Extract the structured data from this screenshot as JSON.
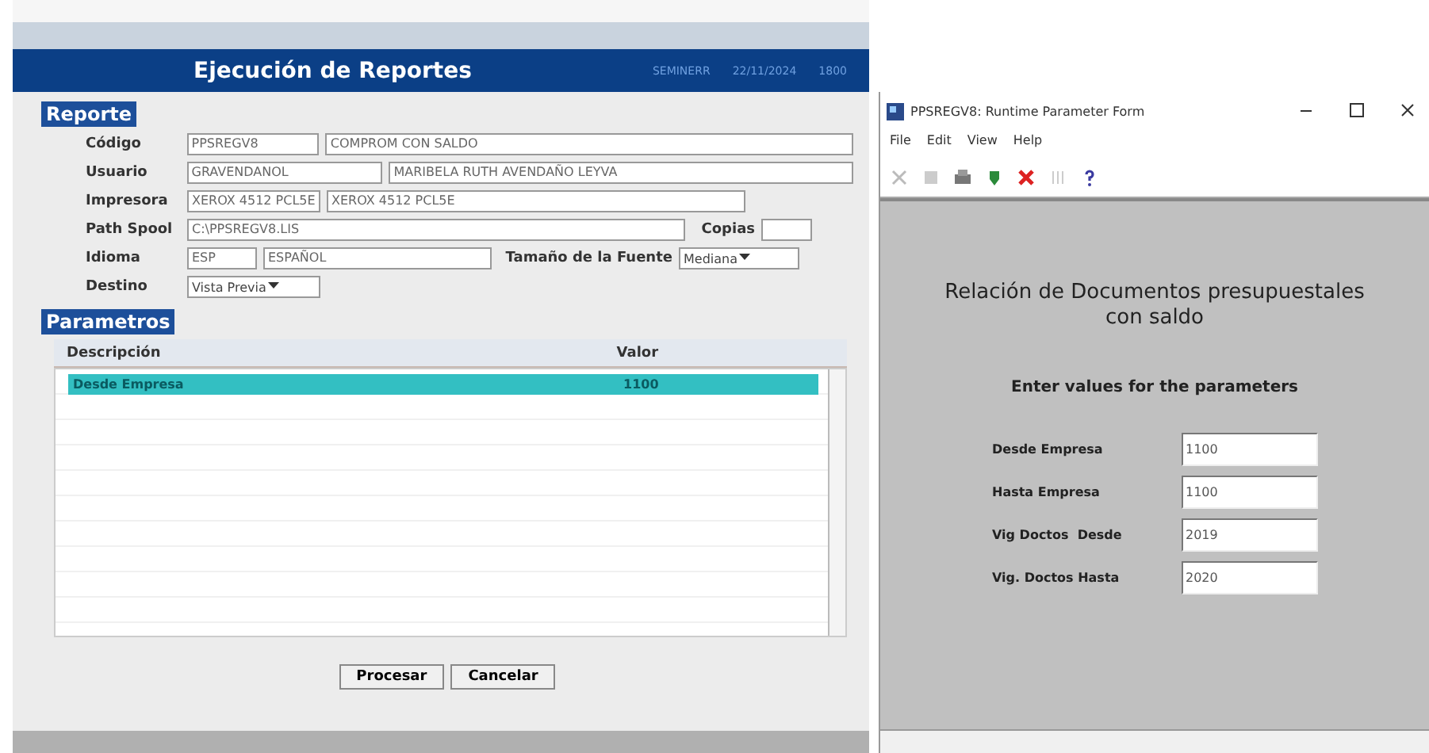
{
  "app_window": {
    "title": "Ejecución de Reportes",
    "header_info": [
      "SEMINERR",
      "22/11/2024",
      "1800"
    ]
  },
  "reporte": {
    "heading": "Reporte",
    "fields": [
      {
        "label": "Código",
        "values": [
          "PPSREGV8",
          "COMPROM CON SALDO"
        ]
      },
      {
        "label": "Usuario",
        "values": [
          "GRAVENDANOL",
          "MARIBELA RUTH AVENDAÑO LEYVA"
        ]
      },
      {
        "label": "Impresora",
        "values": [
          "XEROX 4512 PCL5E",
          "XEROX 4512 PCL5E"
        ]
      },
      {
        "label": "Path Spool",
        "values": [
          "C:\\PPSREGV8.LIS"
        ]
      },
      {
        "label": "Idioma",
        "values": [
          "ESP",
          "ESPAÑOL"
        ]
      },
      {
        "label": "Destino",
        "values": [
          "Vista Previa"
        ]
      }
    ],
    "copias_label": "Copias",
    "font_size_label": "Tamaño de la Fuente",
    "font_size_value": "Mediana"
  },
  "parametros": {
    "heading": "Parametros",
    "columns": [
      "Descripción",
      "Valor"
    ],
    "rows": [
      {
        "description": "Desde Empresa",
        "value": "1100",
        "selected": true
      }
    ]
  },
  "buttons": [
    "Procesar",
    "Cancelar"
  ],
  "param_window": {
    "title": "PPSREGV8: Runtime Parameter Form",
    "menu": [
      "File",
      "Edit",
      "View",
      "Help"
    ],
    "heading": "Relación de Documentos presupuestales con saldo",
    "prompt": "Enter values for the parameters",
    "fields": [
      {
        "label": "Desde Empresa",
        "value": "1100"
      },
      {
        "label": "Hasta Empresa",
        "value": "1100"
      },
      {
        "label": "Vig Doctos  Desde",
        "value": "2019"
      },
      {
        "label": "Vig. Doctos Hasta",
        "value": "2020"
      }
    ]
  }
}
